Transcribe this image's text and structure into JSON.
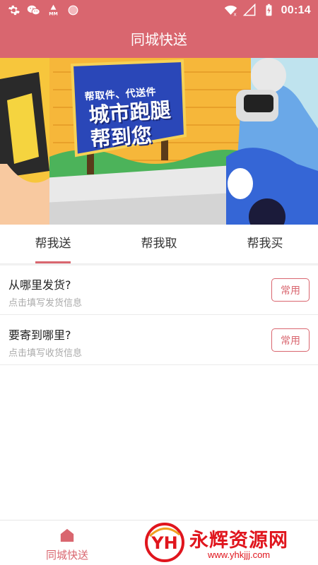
{
  "status_bar": {
    "time": "00:14",
    "left_icons": [
      "gear-icon",
      "wechat-icon",
      "mm-icon",
      "record-icon"
    ],
    "right_icons": [
      "wifi-icon",
      "signal-icon",
      "battery-charging-icon"
    ],
    "mm_text": "MM"
  },
  "app_bar": {
    "title": "同城快送"
  },
  "banner": {
    "line_small": "帮取件、代送件",
    "line_big1": "城市跑腿",
    "line_big2": "帮到您",
    "active_slide": 1,
    "total_slides": 2
  },
  "tabs": [
    {
      "label": "帮我送",
      "active": true
    },
    {
      "label": "帮我取",
      "active": false
    },
    {
      "label": "帮我买",
      "active": false
    }
  ],
  "sender": {
    "title": "从哪里发货?",
    "hint": "点击填写发货信息",
    "button": "常用"
  },
  "receiver": {
    "title": "要寄到哪里?",
    "hint": "点击填写收货信息",
    "button": "常用"
  },
  "bottom_nav": {
    "item1": {
      "label": "同城快送",
      "icon": "home-icon",
      "active": true
    }
  },
  "watermark": {
    "logo_text": "YH",
    "title": "永辉资源网",
    "url": "www.yhkjjj.com"
  },
  "colors": {
    "primary": "#d9666f",
    "watermark_red": "#e0151d",
    "banner_blue": "#2a47b8",
    "banner_yellow": "#f3c24a"
  }
}
